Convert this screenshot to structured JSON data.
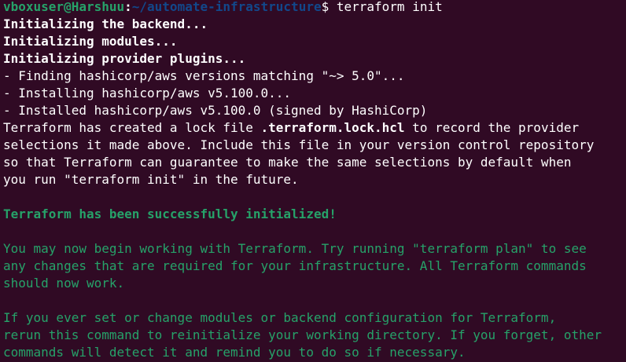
{
  "prompt": {
    "user_host": "vboxuser@Harshuu",
    "separator": ":",
    "path": "~/automate-infrastructure",
    "symbol": "$ ",
    "command": "terraform init"
  },
  "output": {
    "init_backend": "Initializing the backend...",
    "init_modules": "Initializing modules...",
    "init_plugins": "Initializing provider plugins...",
    "finding": "- Finding hashicorp/aws versions matching \"~> 5.0\"...",
    "installing": "- Installing hashicorp/aws v5.100.0...",
    "installed": "- Installed hashicorp/aws v5.100.0 (signed by HashiCorp)",
    "lock_pre": "Terraform has created a lock file ",
    "lock_file": ".terraform.lock.hcl",
    "lock_post": " to record the provider",
    "lock_line2": "selections it made above. Include this file in your version control repository",
    "lock_line3": "so that Terraform can guarantee to make the same selections by default when",
    "lock_line4": "you run \"terraform init\" in the future.",
    "success": "Terraform has been successfully initialized!",
    "begin_line1": "You may now begin working with Terraform. Try running \"terraform plan\" to see",
    "begin_line2": "any changes that are required for your infrastructure. All Terraform commands",
    "begin_line3": "should now work.",
    "rerun_line1": "If you ever set or change modules or backend configuration for Terraform,",
    "rerun_line2": "rerun this command to reinitialize your working directory. If you forget, other",
    "rerun_line3": "commands will detect it and remind you to do so if necessary."
  },
  "colors": {
    "background": "#300a24",
    "text": "#ffffff",
    "green": "#26a269",
    "blue": "#12488b"
  }
}
